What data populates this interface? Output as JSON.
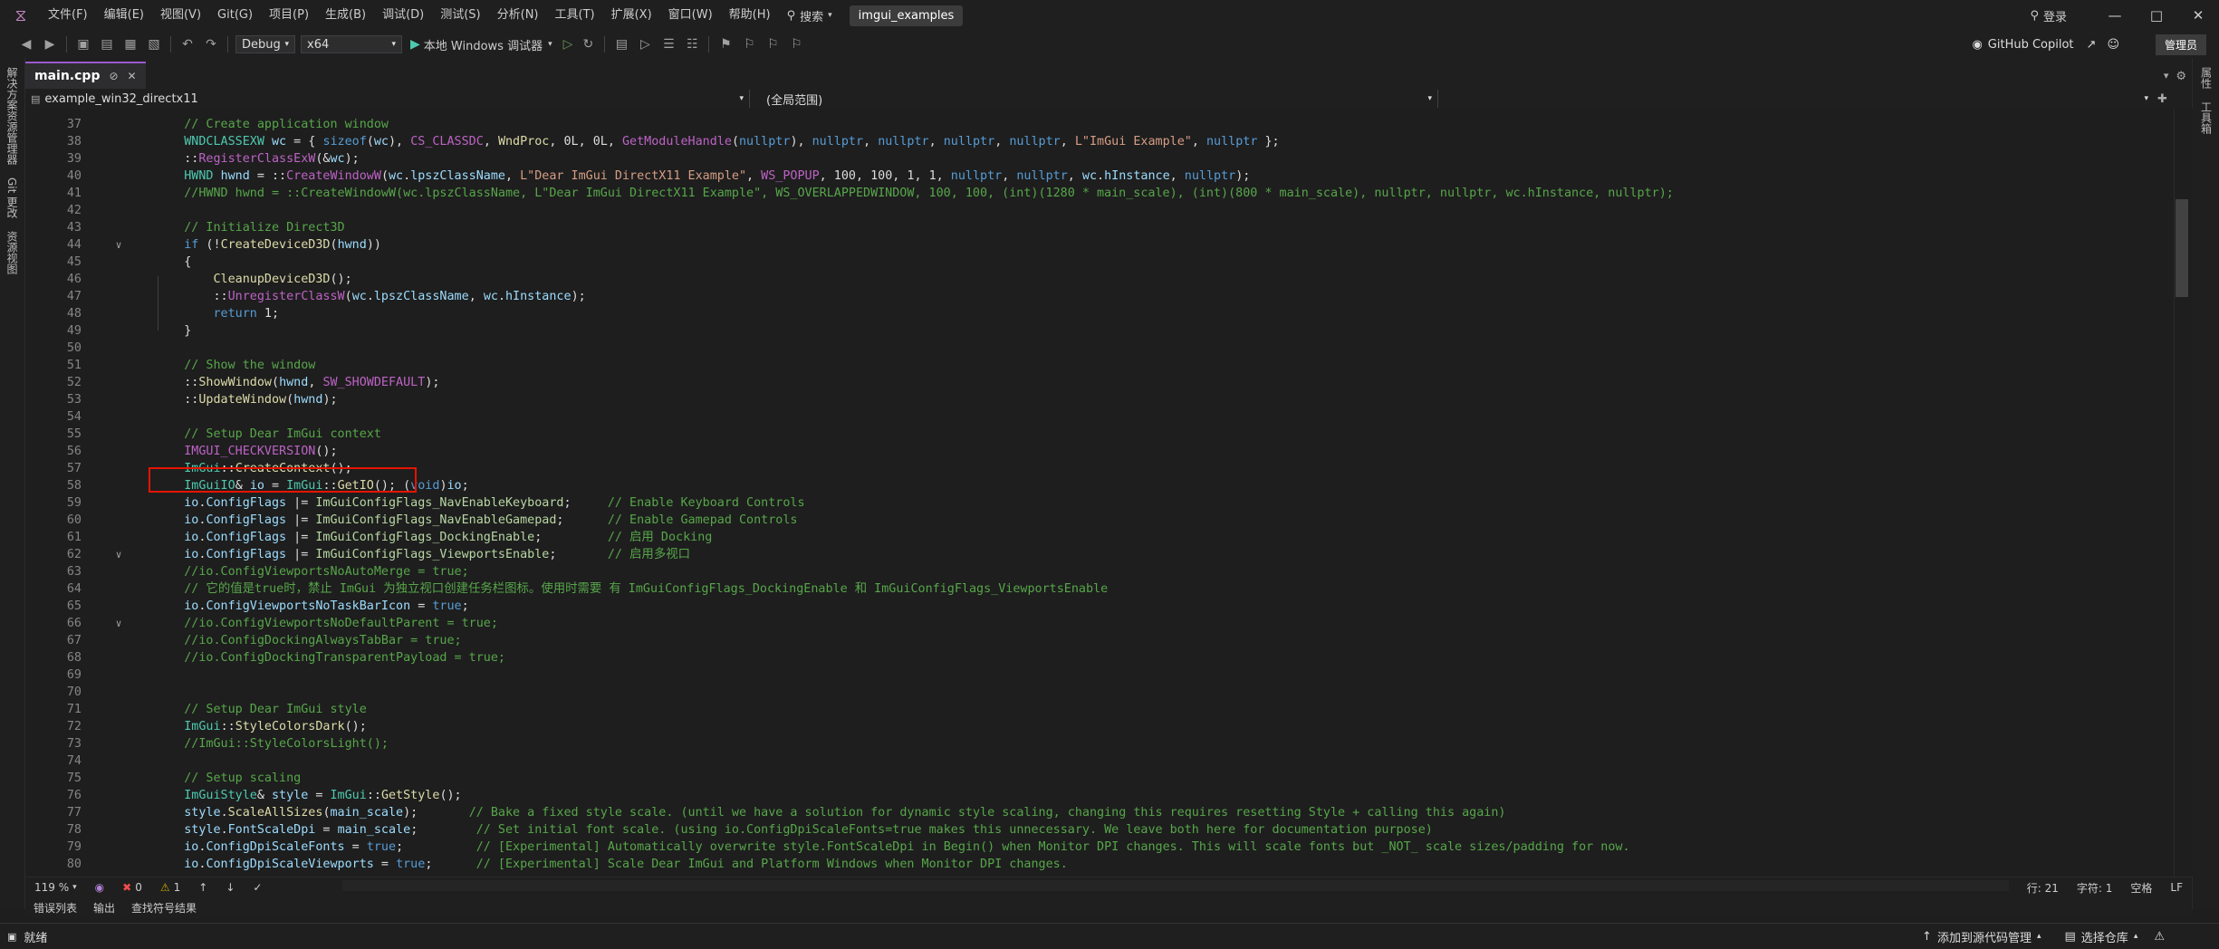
{
  "titlebar": {
    "menu": [
      "文件(F)",
      "编辑(E)",
      "视图(V)",
      "Git(G)",
      "项目(P)",
      "生成(B)",
      "调试(D)",
      "测试(S)",
      "分析(N)",
      "工具(T)",
      "扩展(X)",
      "窗口(W)",
      "帮助(H)"
    ],
    "search": "搜索",
    "solution": "imgui_examples",
    "login": "登录"
  },
  "toolbar": {
    "config": "Debug",
    "platform": "x64",
    "run_label": "本地 Windows 调试器",
    "copilot": "GitHub Copilot",
    "admin": "管理员"
  },
  "left_sidebar": [
    "解决方案资源管理器",
    "Git 更改",
    "资源视图"
  ],
  "right_sidebar": [
    "属性",
    "工具箱"
  ],
  "tab": {
    "name": "main.cpp"
  },
  "navbar": {
    "project": "example_win32_directx11",
    "scope": "(全局范围)"
  },
  "highlight": {
    "line": "58"
  },
  "code_lines": [
    {
      "n": "37",
      "fold": "",
      "segs": [
        [
          "    ",
          "pl"
        ],
        [
          "// Create application window",
          "com"
        ]
      ]
    },
    {
      "n": "38",
      "fold": "",
      "segs": [
        [
          "    ",
          "pl"
        ],
        [
          "WNDCLASSEXW",
          "type"
        ],
        [
          " ",
          "pl"
        ],
        [
          "wc",
          "var"
        ],
        [
          " = { ",
          "pl"
        ],
        [
          "sizeof",
          "kw"
        ],
        [
          "(",
          "pl"
        ],
        [
          "wc",
          "var"
        ],
        [
          "), ",
          "pl"
        ],
        [
          "CS_CLASSDC",
          "mac"
        ],
        [
          ", ",
          "pl"
        ],
        [
          "WndProc",
          "fn"
        ],
        [
          ", 0L, 0L, ",
          "pl"
        ],
        [
          "GetModuleHandle",
          "mac"
        ],
        [
          "(",
          "pl"
        ],
        [
          "nullptr",
          "kw"
        ],
        [
          "), ",
          "pl"
        ],
        [
          "nullptr",
          "kw"
        ],
        [
          ", ",
          "pl"
        ],
        [
          "nullptr",
          "kw"
        ],
        [
          ", ",
          "pl"
        ],
        [
          "nullptr",
          "kw"
        ],
        [
          ", ",
          "pl"
        ],
        [
          "nullptr",
          "kw"
        ],
        [
          ", ",
          "pl"
        ],
        [
          "L\"ImGui Example\"",
          "str"
        ],
        [
          ", ",
          "pl"
        ],
        [
          "nullptr",
          "kw"
        ],
        [
          " };",
          "pl"
        ]
      ]
    },
    {
      "n": "39",
      "fold": "",
      "segs": [
        [
          "    ::",
          "pl"
        ],
        [
          "RegisterClassExW",
          "mac"
        ],
        [
          "(&",
          "pl"
        ],
        [
          "wc",
          "var"
        ],
        [
          ");",
          "pl"
        ]
      ]
    },
    {
      "n": "40",
      "fold": "",
      "segs": [
        [
          "    ",
          "pl"
        ],
        [
          "HWND",
          "type"
        ],
        [
          " ",
          "pl"
        ],
        [
          "hwnd",
          "var"
        ],
        [
          " = ::",
          "pl"
        ],
        [
          "CreateWindowW",
          "mac"
        ],
        [
          "(",
          "pl"
        ],
        [
          "wc",
          "var"
        ],
        [
          ".",
          "pl"
        ],
        [
          "lpszClassName",
          "var"
        ],
        [
          ", ",
          "pl"
        ],
        [
          "L\"Dear ImGui DirectX11 Example\"",
          "str"
        ],
        [
          ", ",
          "pl"
        ],
        [
          "WS_POPUP",
          "mac"
        ],
        [
          ", 100, 100, 1, 1, ",
          "pl"
        ],
        [
          "nullptr",
          "kw"
        ],
        [
          ", ",
          "pl"
        ],
        [
          "nullptr",
          "kw"
        ],
        [
          ", ",
          "pl"
        ],
        [
          "wc",
          "var"
        ],
        [
          ".",
          "pl"
        ],
        [
          "hInstance",
          "var"
        ],
        [
          ", ",
          "pl"
        ],
        [
          "nullptr",
          "kw"
        ],
        [
          ");",
          "pl"
        ]
      ]
    },
    {
      "n": "41",
      "fold": "",
      "segs": [
        [
          "    ",
          "pl"
        ],
        [
          "//HWND hwnd = ::CreateWindowW(wc.lpszClassName, L\"Dear ImGui DirectX11 Example\", WS_OVERLAPPEDWINDOW, 100, 100, (int)(1280 * main_scale), (int)(800 * main_scale), nullptr, nullptr, wc.hInstance, nullptr);",
          "com"
        ]
      ]
    },
    {
      "n": "42",
      "fold": "",
      "segs": []
    },
    {
      "n": "43",
      "fold": "",
      "segs": [
        [
          "    ",
          "pl"
        ],
        [
          "// Initialize Direct3D",
          "com"
        ]
      ]
    },
    {
      "n": "44",
      "fold": "v",
      "segs": [
        [
          "    ",
          "pl"
        ],
        [
          "if",
          "kw"
        ],
        [
          " (!",
          "pl"
        ],
        [
          "CreateDeviceD3D",
          "fn"
        ],
        [
          "(",
          "pl"
        ],
        [
          "hwnd",
          "var"
        ],
        [
          "))",
          "pl"
        ]
      ]
    },
    {
      "n": "45",
      "fold": "",
      "segs": [
        [
          "    {",
          "pl"
        ]
      ]
    },
    {
      "n": "46",
      "fold": "",
      "segs": [
        [
          "        ",
          "pl"
        ],
        [
          "CleanupDeviceD3D",
          "fn"
        ],
        [
          "();",
          "pl"
        ]
      ]
    },
    {
      "n": "47",
      "fold": "",
      "segs": [
        [
          "        ::",
          "pl"
        ],
        [
          "UnregisterClassW",
          "mac"
        ],
        [
          "(",
          "pl"
        ],
        [
          "wc",
          "var"
        ],
        [
          ".",
          "pl"
        ],
        [
          "lpszClassName",
          "var"
        ],
        [
          ", ",
          "pl"
        ],
        [
          "wc",
          "var"
        ],
        [
          ".",
          "pl"
        ],
        [
          "hInstance",
          "var"
        ],
        [
          ");",
          "pl"
        ]
      ]
    },
    {
      "n": "48",
      "fold": "",
      "segs": [
        [
          "        ",
          "pl"
        ],
        [
          "return",
          "kw"
        ],
        [
          " 1;",
          "pl"
        ]
      ]
    },
    {
      "n": "49",
      "fold": "",
      "segs": [
        [
          "    }",
          "pl"
        ]
      ]
    },
    {
      "n": "50",
      "fold": "",
      "segs": []
    },
    {
      "n": "51",
      "fold": "",
      "segs": [
        [
          "    ",
          "pl"
        ],
        [
          "// Show the window",
          "com"
        ]
      ]
    },
    {
      "n": "52",
      "fold": "",
      "segs": [
        [
          "    ::",
          "pl"
        ],
        [
          "ShowWindow",
          "fn"
        ],
        [
          "(",
          "pl"
        ],
        [
          "hwnd",
          "var"
        ],
        [
          ", ",
          "pl"
        ],
        [
          "SW_SHOWDEFAULT",
          "mac"
        ],
        [
          ");",
          "pl"
        ]
      ]
    },
    {
      "n": "53",
      "fold": "",
      "segs": [
        [
          "    ::",
          "pl"
        ],
        [
          "UpdateWindow",
          "fn"
        ],
        [
          "(",
          "pl"
        ],
        [
          "hwnd",
          "var"
        ],
        [
          ");",
          "pl"
        ]
      ]
    },
    {
      "n": "54",
      "fold": "",
      "segs": []
    },
    {
      "n": "55",
      "fold": "",
      "segs": [
        [
          "    ",
          "pl"
        ],
        [
          "// Setup Dear ImGui context",
          "com"
        ]
      ]
    },
    {
      "n": "56",
      "fold": "",
      "segs": [
        [
          "    ",
          "pl"
        ],
        [
          "IMGUI_CHECKVERSION",
          "mac"
        ],
        [
          "();",
          "pl"
        ]
      ]
    },
    {
      "n": "57",
      "fold": "",
      "segs": [
        [
          "    ",
          "pl"
        ],
        [
          "ImGui",
          "type"
        ],
        [
          "::",
          "pl"
        ],
        [
          "CreateContext",
          "fn"
        ],
        [
          "();",
          "pl"
        ]
      ]
    },
    {
      "n": "58",
      "fold": "",
      "segs": [
        [
          "    ",
          "pl"
        ],
        [
          "ImGuiIO",
          "type"
        ],
        [
          "& ",
          "pl"
        ],
        [
          "io",
          "var"
        ],
        [
          " = ",
          "pl"
        ],
        [
          "ImGui",
          "type"
        ],
        [
          "::",
          "pl"
        ],
        [
          "GetIO",
          "fn"
        ],
        [
          "(); (",
          "pl"
        ],
        [
          "void",
          "kw"
        ],
        [
          ")",
          "pl"
        ],
        [
          "io",
          "var"
        ],
        [
          ";",
          "pl"
        ]
      ]
    },
    {
      "n": "59",
      "fold": "",
      "segs": [
        [
          "    ",
          "pl"
        ],
        [
          "io",
          "var"
        ],
        [
          ".",
          "pl"
        ],
        [
          "ConfigFlags",
          "var"
        ],
        [
          " |= ",
          "pl"
        ],
        [
          "ImGuiConfigFlags_NavEnableKeyboard",
          "enum"
        ],
        [
          ";     ",
          "pl"
        ],
        [
          "// Enable Keyboard Controls",
          "com"
        ]
      ]
    },
    {
      "n": "60",
      "fold": "",
      "segs": [
        [
          "    ",
          "pl"
        ],
        [
          "io",
          "var"
        ],
        [
          ".",
          "pl"
        ],
        [
          "ConfigFlags",
          "var"
        ],
        [
          " |= ",
          "pl"
        ],
        [
          "ImGuiConfigFlags_NavEnableGamepad",
          "enum"
        ],
        [
          ";      ",
          "pl"
        ],
        [
          "// Enable Gamepad Controls",
          "com"
        ]
      ]
    },
    {
      "n": "61",
      "fold": "",
      "segs": [
        [
          "    ",
          "pl"
        ],
        [
          "io",
          "var"
        ],
        [
          ".",
          "pl"
        ],
        [
          "ConfigFlags",
          "var"
        ],
        [
          " |= ",
          "pl"
        ],
        [
          "ImGuiConfigFlags_DockingEnable",
          "enum"
        ],
        [
          ";         ",
          "pl"
        ],
        [
          "// 启用 Docking",
          "com"
        ]
      ]
    },
    {
      "n": "62",
      "fold": "v",
      "segs": [
        [
          "    ",
          "pl"
        ],
        [
          "io",
          "var"
        ],
        [
          ".",
          "pl"
        ],
        [
          "ConfigFlags",
          "var"
        ],
        [
          " |= ",
          "pl"
        ],
        [
          "ImGuiConfigFlags_ViewportsEnable",
          "enum"
        ],
        [
          ";       ",
          "pl"
        ],
        [
          "// 启用多视口",
          "com"
        ]
      ]
    },
    {
      "n": "63",
      "fold": "",
      "segs": [
        [
          "    ",
          "pl"
        ],
        [
          "//io.ConfigViewportsNoAutoMerge = true;",
          "com"
        ]
      ]
    },
    {
      "n": "64",
      "fold": "",
      "segs": [
        [
          "    ",
          "pl"
        ],
        [
          "// 它的值是true时，禁止 ImGui 为独立视口创建任务栏图标。使用时需要 有 ImGuiConfigFlags_DockingEnable 和 ImGuiConfigFlags_ViewportsEnable",
          "com"
        ]
      ]
    },
    {
      "n": "65",
      "fold": "",
      "segs": [
        [
          "    ",
          "pl"
        ],
        [
          "io",
          "var"
        ],
        [
          ".",
          "pl"
        ],
        [
          "ConfigViewportsNoTaskBarIcon",
          "var"
        ],
        [
          " = ",
          "pl"
        ],
        [
          "true",
          "kw"
        ],
        [
          ";",
          "pl"
        ]
      ]
    },
    {
      "n": "66",
      "fold": "v",
      "segs": [
        [
          "    ",
          "pl"
        ],
        [
          "//io.ConfigViewportsNoDefaultParent = true;",
          "com"
        ]
      ]
    },
    {
      "n": "67",
      "fold": "",
      "segs": [
        [
          "    ",
          "pl"
        ],
        [
          "//io.ConfigDockingAlwaysTabBar = true;",
          "com"
        ]
      ]
    },
    {
      "n": "68",
      "fold": "",
      "segs": [
        [
          "    ",
          "pl"
        ],
        [
          "//io.ConfigDockingTransparentPayload = true;",
          "com"
        ]
      ]
    },
    {
      "n": "69",
      "fold": "",
      "segs": []
    },
    {
      "n": "70",
      "fold": "",
      "segs": []
    },
    {
      "n": "71",
      "fold": "",
      "segs": [
        [
          "    ",
          "pl"
        ],
        [
          "// Setup Dear ImGui style",
          "com"
        ]
      ]
    },
    {
      "n": "72",
      "fold": "",
      "segs": [
        [
          "    ",
          "pl"
        ],
        [
          "ImGui",
          "type"
        ],
        [
          "::",
          "pl"
        ],
        [
          "StyleColorsDark",
          "fn"
        ],
        [
          "();",
          "pl"
        ]
      ]
    },
    {
      "n": "73",
      "fold": "",
      "segs": [
        [
          "    ",
          "pl"
        ],
        [
          "//ImGui::StyleColorsLight();",
          "com"
        ]
      ]
    },
    {
      "n": "74",
      "fold": "",
      "segs": []
    },
    {
      "n": "75",
      "fold": "",
      "segs": [
        [
          "    ",
          "pl"
        ],
        [
          "// Setup scaling",
          "com"
        ]
      ]
    },
    {
      "n": "76",
      "fold": "",
      "segs": [
        [
          "    ",
          "pl"
        ],
        [
          "ImGuiStyle",
          "type"
        ],
        [
          "& ",
          "pl"
        ],
        [
          "style",
          "var"
        ],
        [
          " = ",
          "pl"
        ],
        [
          "ImGui",
          "type"
        ],
        [
          "::",
          "pl"
        ],
        [
          "GetStyle",
          "fn"
        ],
        [
          "();",
          "pl"
        ]
      ]
    },
    {
      "n": "77",
      "fold": "",
      "segs": [
        [
          "    ",
          "pl"
        ],
        [
          "style",
          "var"
        ],
        [
          ".",
          "pl"
        ],
        [
          "ScaleAllSizes",
          "fn"
        ],
        [
          "(",
          "pl"
        ],
        [
          "main_scale",
          "var"
        ],
        [
          ");       ",
          "pl"
        ],
        [
          "// Bake a fixed style scale. (until we have a solution for dynamic style scaling, changing this requires resetting Style + calling this again)",
          "com"
        ]
      ]
    },
    {
      "n": "78",
      "fold": "",
      "segs": [
        [
          "    ",
          "pl"
        ],
        [
          "style",
          "var"
        ],
        [
          ".",
          "pl"
        ],
        [
          "FontScaleDpi",
          "var"
        ],
        [
          " = ",
          "pl"
        ],
        [
          "main_scale",
          "var"
        ],
        [
          ";        ",
          "pl"
        ],
        [
          "// Set initial font scale. (using io.ConfigDpiScaleFonts=true makes this unnecessary. We leave both here for documentation purpose)",
          "com"
        ]
      ]
    },
    {
      "n": "79",
      "fold": "",
      "segs": [
        [
          "    ",
          "pl"
        ],
        [
          "io",
          "var"
        ],
        [
          ".",
          "pl"
        ],
        [
          "ConfigDpiScaleFonts",
          "var"
        ],
        [
          " = ",
          "pl"
        ],
        [
          "true",
          "kw"
        ],
        [
          ";          ",
          "pl"
        ],
        [
          "// [Experimental] Automatically overwrite style.FontScaleDpi in Begin() when Monitor DPI changes. This will scale fonts but _NOT_ scale sizes/padding for now.",
          "com"
        ]
      ]
    },
    {
      "n": "80",
      "fold": "",
      "segs": [
        [
          "    ",
          "pl"
        ],
        [
          "io",
          "var"
        ],
        [
          ".",
          "pl"
        ],
        [
          "ConfigDpiScaleViewports",
          "var"
        ],
        [
          " = ",
          "pl"
        ],
        [
          "true",
          "kw"
        ],
        [
          ";      ",
          "pl"
        ],
        [
          "// [Experimental] Scale Dear ImGui and Platform Windows when Monitor DPI changes.",
          "com"
        ]
      ]
    }
  ],
  "editor_status": {
    "zoom": "119 %",
    "errors": "0",
    "warnings": "1",
    "line": "行: 21",
    "char": "字符: 1",
    "spaces": "空格",
    "eol": "LF"
  },
  "panel_tabs": [
    "错误列表",
    "输出",
    "查找符号结果"
  ],
  "statusbar": {
    "ready": "就绪",
    "add_source": "添加到源代码管理",
    "select_repo": "选择仓库"
  }
}
